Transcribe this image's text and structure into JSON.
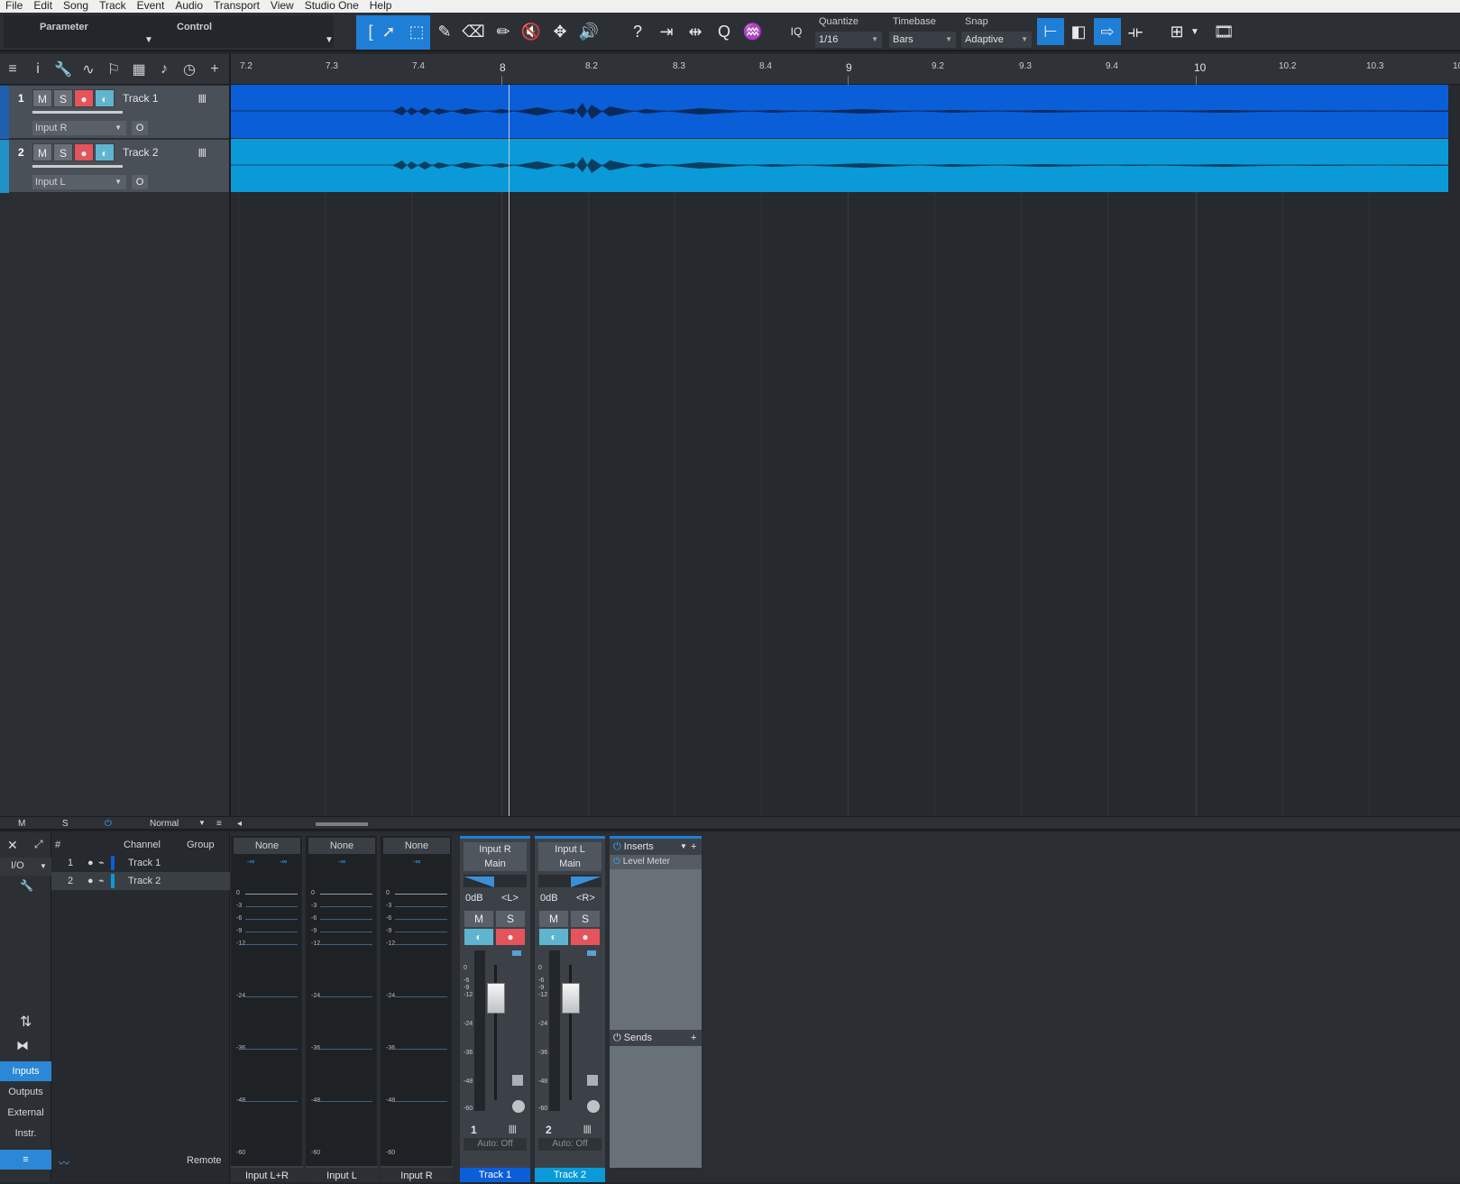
{
  "menu": [
    "File",
    "Edit",
    "Song",
    "Track",
    "Event",
    "Audio",
    "Transport",
    "View",
    "Studio One",
    "Help"
  ],
  "toolbar": {
    "parameter_label": "Parameter",
    "control_label": "Control",
    "iq_label": "IQ",
    "quantize_label": "Quantize",
    "quantize_value": "1/16",
    "timebase_label": "Timebase",
    "timebase_value": "Bars",
    "snap_label": "Snap",
    "snap_value": "Adaptive"
  },
  "tracks": [
    {
      "num": "1",
      "name": "Track 1",
      "input": "Input R",
      "color": "#0a5fd8",
      "mute": "M",
      "solo": "S"
    },
    {
      "num": "2",
      "name": "Track 2",
      "input": "Input L",
      "color": "#0a9ad8",
      "mute": "M",
      "solo": "S"
    }
  ],
  "ruler": {
    "minor_labels": [
      "7.2",
      "7.3",
      "7.4",
      "8.2",
      "8.3",
      "8.4",
      "9.2",
      "9.3",
      "9.4",
      "10.2",
      "10.3",
      "10"
    ],
    "major_labels": [
      "8",
      "9",
      "10"
    ]
  },
  "status": {
    "m": "M",
    "s": "S",
    "mode": "Normal"
  },
  "console": {
    "nav": {
      "io": "I/O",
      "inputs": "Inputs",
      "outputs": "Outputs",
      "external": "External",
      "instr": "Instr.",
      "remote": "Remote"
    },
    "list_headers": {
      "num": "#",
      "channel": "Channel",
      "group": "Group"
    },
    "channels": [
      {
        "num": "1",
        "name": "Track 1"
      },
      {
        "num": "2",
        "name": "Track 2"
      }
    ],
    "input_channels": [
      {
        "route": "None",
        "name": "Input L+R",
        "inf": "-∞"
      },
      {
        "route": "None",
        "name": "Input L",
        "inf": "-∞"
      },
      {
        "route": "None",
        "name": "Input R",
        "inf": "-∞"
      }
    ],
    "meter_scale": [
      "0",
      "-3",
      "-6",
      "-9",
      "-12",
      "-24",
      "-36",
      "-48",
      "-60"
    ],
    "strips": [
      {
        "input": "Input R",
        "output": "Main",
        "volume": "0dB",
        "pan": "<L>",
        "num": "1",
        "name": "Track 1",
        "auto": "Auto: Off",
        "color": "#0a5fd8"
      },
      {
        "input": "Input L",
        "output": "Main",
        "volume": "0dB",
        "pan": "<R>",
        "num": "2",
        "name": "Track 2",
        "auto": "Auto: Off",
        "color": "#0a9ad8"
      }
    ],
    "fader_scale": [
      "0",
      "-6",
      "-9",
      "-12",
      "-24",
      "-36",
      "-48",
      "-60"
    ],
    "inserts_label": "Inserts",
    "insert_item": "Level Meter",
    "sends_label": "Sends"
  }
}
